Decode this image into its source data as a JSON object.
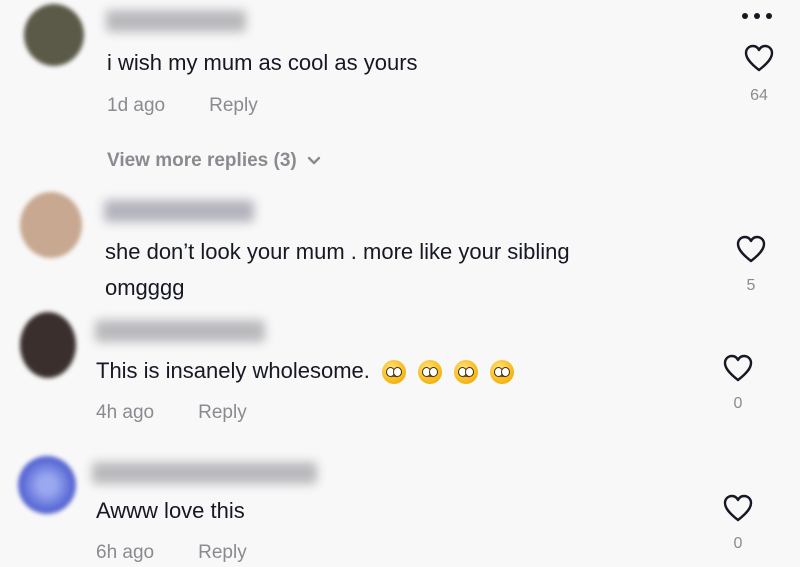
{
  "comments": [
    {
      "username": "xxxxxxx",
      "text": "i wish my mum as cool as yours",
      "time": "1d ago",
      "reply_label": "Reply",
      "likes": "64",
      "avatar_color": "#5b5a48"
    },
    {
      "username": "xxxxx",
      "text_line1": "she don’t look your mum . more like your sibling",
      "text_line2": "omgggg",
      "likes": "5",
      "avatar_color": "#c8a890"
    },
    {
      "username": "xxxxxxxxxx",
      "text": "This is insanely wholesome.",
      "time": "4h ago",
      "reply_label": "Reply",
      "likes": "0",
      "avatar_color": "#3a2f2c",
      "emoji_count": 4,
      "emoji": "pleading-face"
    },
    {
      "username": "xxxxxxxxxxxxx",
      "text": "Awww love this",
      "time": "6h ago",
      "reply_label": "Reply",
      "likes": "0",
      "avatar_color": "#5b6bd6"
    }
  ],
  "view_more_replies": "View more replies (3)",
  "icons": {
    "more": "more-dots-icon",
    "like": "heart-outline-icon",
    "expand": "chevron-down-icon"
  },
  "colors": {
    "text": "#161823",
    "secondary": "#8a8b91",
    "background": "#f8f8f8"
  }
}
